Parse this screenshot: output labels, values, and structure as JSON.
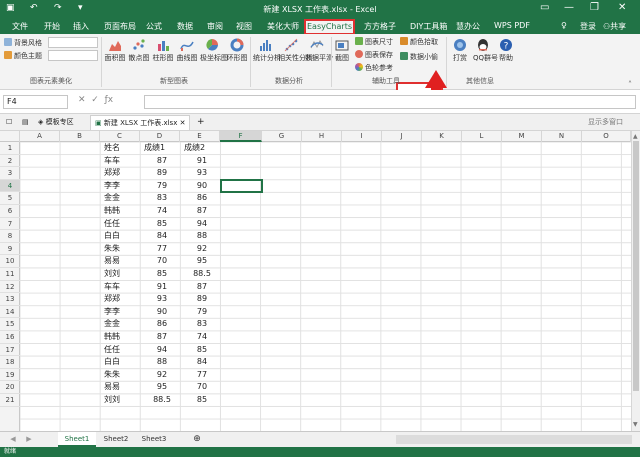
{
  "title": "新建 XLSX 工作表.xlsx - Excel",
  "ribbon_tabs": [
    "文件",
    "开始",
    "插入",
    "页面布局",
    "公式",
    "数据",
    "审阅",
    "视图",
    "美化大师",
    "EasyCharts",
    "方方格子",
    "DIY工具箱",
    "慧办公",
    "WPS PDF"
  ],
  "account": {
    "login": "登录",
    "share": "共享"
  },
  "ribbon": {
    "style_items": [
      "背景风格",
      "颜色主题"
    ],
    "group_style": "图表元素美化",
    "chart_buttons": [
      "面积图",
      "散点图",
      "柱形图",
      "曲线图",
      "极坐标图",
      "环形图"
    ],
    "group_chart": "新型图表",
    "analysis_buttons": [
      "统计分析",
      "相关性分析",
      "数据平滑"
    ],
    "group_analysis": "数据分析",
    "screenshot_button": "截图",
    "aux_items": [
      "图表尺寸",
      "图表保存",
      "色轮参考"
    ],
    "color_pick": "颜色拾取",
    "data_mini": "数据小偷",
    "group_aux": "辅助工具",
    "other_buttons": [
      "打赏",
      "QQ群号",
      "帮助"
    ],
    "group_other": "其他信息",
    "colors": {
      "brand": "#217346",
      "highlight": "#e03030"
    }
  },
  "formula": {
    "namebox": "F4",
    "value": ""
  },
  "doc_tabs": {
    "template": "模板专区",
    "workbook": "新建 XLSX 工作表.xlsx",
    "new_tab": "+",
    "show_window": "显示多窗口"
  },
  "columns": [
    "A",
    "B",
    "C",
    "D",
    "E",
    "F",
    "G",
    "H",
    "I",
    "J",
    "K",
    "L",
    "M",
    "N",
    "O"
  ],
  "rows": [
    "1",
    "2",
    "3",
    "4",
    "5",
    "6",
    "7",
    "8",
    "9",
    "10",
    "11",
    "12",
    "13",
    "14",
    "15",
    "16",
    "17",
    "18",
    "19",
    "20",
    "21"
  ],
  "table": {
    "header": [
      "姓名",
      "成绩1",
      "成绩2"
    ],
    "data": [
      [
        "车车",
        "87",
        "91"
      ],
      [
        "郑郑",
        "89",
        "93"
      ],
      [
        "李李",
        "79",
        "90"
      ],
      [
        "金金",
        "83",
        "86"
      ],
      [
        "韩韩",
        "74",
        "87"
      ],
      [
        "任任",
        "85",
        "94"
      ],
      [
        "白白",
        "84",
        "88"
      ],
      [
        "朱朱",
        "77",
        "92"
      ],
      [
        "易易",
        "70",
        "95"
      ],
      [
        "刘刘",
        "85",
        "88.5"
      ],
      [
        "车车",
        "91",
        "87"
      ],
      [
        "郑郑",
        "93",
        "89"
      ],
      [
        "李李",
        "90",
        "79"
      ],
      [
        "金金",
        "86",
        "83"
      ],
      [
        "韩韩",
        "87",
        "74"
      ],
      [
        "任任",
        "94",
        "85"
      ],
      [
        "白白",
        "88",
        "84"
      ],
      [
        "朱朱",
        "92",
        "77"
      ],
      [
        "易易",
        "95",
        "70"
      ],
      [
        "刘刘",
        "88.5",
        "85"
      ]
    ]
  },
  "sheets": [
    "Sheet1",
    "Sheet2",
    "Sheet3"
  ],
  "status": "就绪"
}
